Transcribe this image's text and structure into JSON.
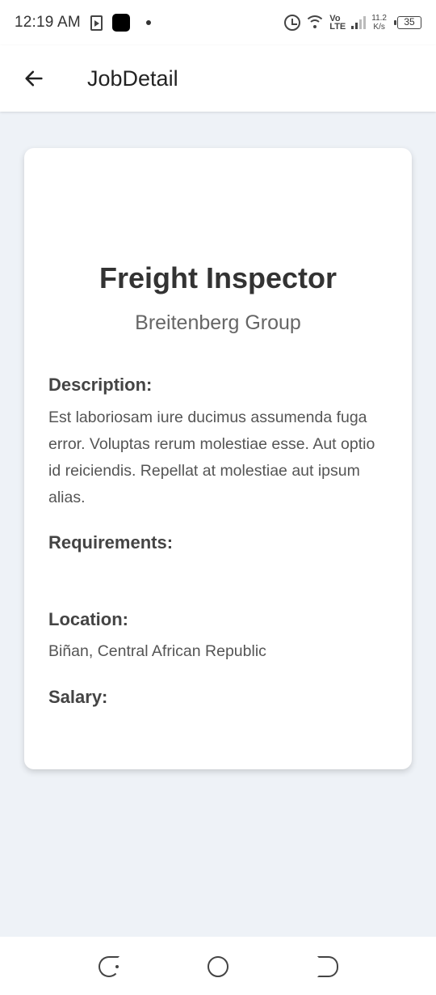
{
  "status_bar": {
    "time": "12:19 AM",
    "volte_top": "Vo",
    "volte_bottom": "LTE",
    "net_speed_value": "11.2",
    "net_speed_unit": "K/s",
    "battery": "35"
  },
  "app_bar": {
    "back_icon": "arrow-left-icon",
    "title": "JobDetail"
  },
  "job": {
    "title": "Freight Inspector",
    "company": "Breitenberg Group",
    "description_label": "Description:",
    "description": "Est laboriosam iure ducimus assumenda fuga error. Voluptas rerum molestiae esse. Aut optio id reiciendis. Repellat at molestiae aut ipsum alias.",
    "requirements_label": "Requirements:",
    "requirements": "",
    "location_label": "Location:",
    "location": "Biñan, Central African Republic",
    "salary_label": "Salary:",
    "salary": ""
  },
  "nav_bar": {
    "recent_icon": "recent-apps-icon",
    "home_icon": "home-circle-icon",
    "back_icon": "back-icon"
  },
  "colors": {
    "background": "#eef2f7",
    "surface": "#ffffff",
    "text_primary": "#333333",
    "text_secondary": "#666666"
  }
}
